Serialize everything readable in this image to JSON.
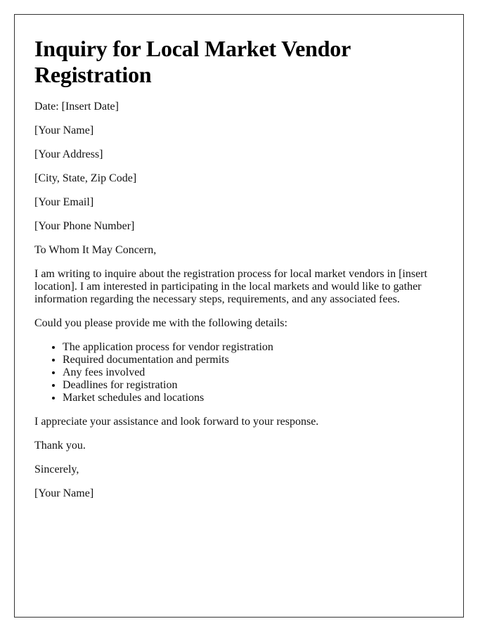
{
  "letter": {
    "title": "Inquiry for Local Market Vendor Registration",
    "date_line": "Date: [Insert Date]",
    "sender": {
      "name": "[Your Name]",
      "address": "[Your Address]",
      "city_state_zip": "[City, State, Zip Code]",
      "email": "[Your Email]",
      "phone": "[Your Phone Number]"
    },
    "salutation": "To Whom It May Concern,",
    "body_paragraph": "I am writing to inquire about the registration process for local market vendors in [insert location]. I am interested in participating in the local markets and would like to gather information regarding the necessary steps, requirements, and any associated fees.",
    "list_intro": "Could you please provide me with the following details:",
    "details": [
      "The application process for vendor registration",
      "Required documentation and permits",
      "Any fees involved",
      "Deadlines for registration",
      "Market schedules and locations"
    ],
    "appreciation": "I appreciate your assistance and look forward to your response.",
    "thanks": "Thank you.",
    "closing": "Sincerely,",
    "signature": "[Your Name]"
  }
}
